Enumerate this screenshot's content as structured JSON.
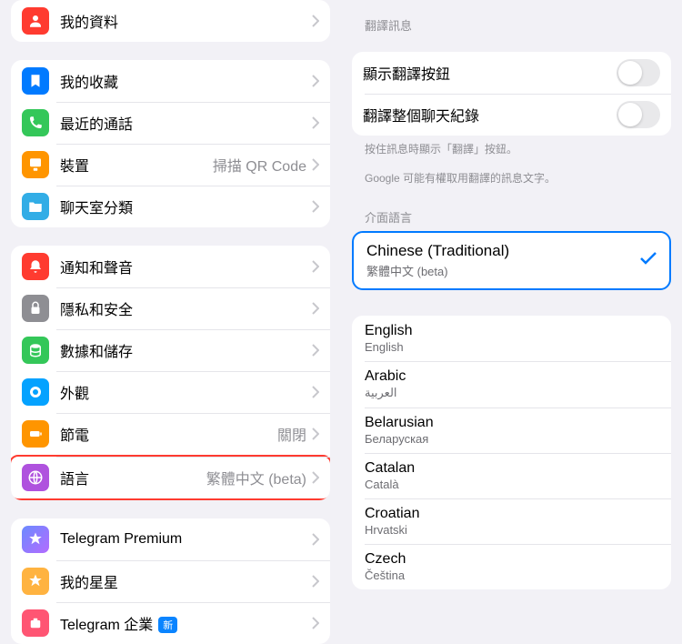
{
  "left": {
    "group1": [
      {
        "label": "我的資料",
        "icon": "person-icon",
        "bg": "#ff3b30"
      }
    ],
    "group2": [
      {
        "label": "我的收藏",
        "icon": "bookmark-icon",
        "bg": "#007aff"
      },
      {
        "label": "最近的通話",
        "icon": "phone-icon",
        "bg": "#34c759"
      },
      {
        "label": "裝置",
        "detail": "掃描 QR Code",
        "icon": "device-icon",
        "bg": "#ff9500"
      },
      {
        "label": "聊天室分類",
        "icon": "folder-icon",
        "bg": "#32ade6"
      }
    ],
    "group3": [
      {
        "label": "通知和聲音",
        "icon": "bell-icon",
        "bg": "#ff3b30"
      },
      {
        "label": "隱私和安全",
        "icon": "lock-icon",
        "bg": "#8e8e93"
      },
      {
        "label": "數據和儲存",
        "icon": "database-icon",
        "bg": "#34c759"
      },
      {
        "label": "外觀",
        "icon": "appearance-icon",
        "bg": "#04a2ff"
      },
      {
        "label": "節電",
        "detail": "關閉",
        "icon": "battery-icon",
        "bg": "#ff9500"
      },
      {
        "label": "語言",
        "detail": "繁體中文 (beta)",
        "icon": "globe-icon",
        "bg": "#af52de",
        "highlight": true
      }
    ],
    "group4": [
      {
        "label": "Telegram Premium",
        "icon": "star-icon",
        "bg": "#9d6bff"
      },
      {
        "label": "我的星星",
        "icon": "star-outline-icon",
        "bg": "#ffb340"
      },
      {
        "label": "Telegram 企業",
        "badge": "新",
        "icon": "business-icon",
        "bg": "#ff5573"
      }
    ]
  },
  "right": {
    "translate_header": "翻譯訊息",
    "show_translate_btn": "顯示翻譯按鈕",
    "translate_chat_history": "翻譯整個聊天紀錄",
    "translate_caption1": "按住訊息時顯示「翻譯」按鈕。",
    "translate_caption2": "Google 可能有權取用翻譯的訊息文字。",
    "lang_header": "介面語言",
    "selected": {
      "primary": "Chinese (Traditional)",
      "secondary": "繁體中文 (beta)"
    },
    "languages": [
      {
        "primary": "English",
        "secondary": "English"
      },
      {
        "primary": "Arabic",
        "secondary": "العربية"
      },
      {
        "primary": "Belarusian",
        "secondary": "Беларуская"
      },
      {
        "primary": "Catalan",
        "secondary": "Català"
      },
      {
        "primary": "Croatian",
        "secondary": "Hrvatski"
      },
      {
        "primary": "Czech",
        "secondary": "Čeština"
      }
    ]
  }
}
